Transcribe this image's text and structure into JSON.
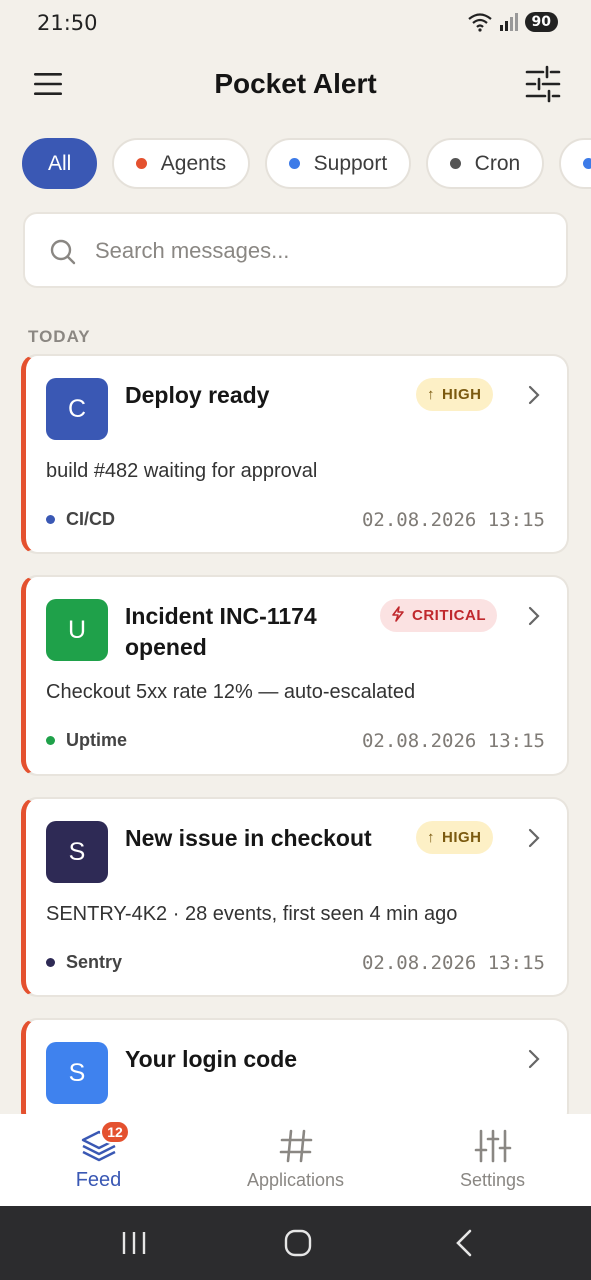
{
  "status_bar": {
    "time": "21:50",
    "battery": "90"
  },
  "header": {
    "title": "Pocket Alert",
    "menu_icon": "hamburger-menu-icon",
    "filter_icon": "sliders-filter-icon"
  },
  "filters": [
    {
      "label": "All",
      "active": true,
      "color": ""
    },
    {
      "label": "Agents",
      "active": false,
      "color": "#e4512f"
    },
    {
      "label": "Support",
      "active": false,
      "color": "#3d7be8"
    },
    {
      "label": "Cron",
      "active": false,
      "color": "#555555"
    }
  ],
  "search": {
    "placeholder": "Search messages..."
  },
  "section": {
    "label": "TODAY"
  },
  "messages": [
    {
      "avatar": "C",
      "avatar_color": "#3a58b4",
      "title": "Deploy ready",
      "priority": "HIGH",
      "priority_icon": "arrow-up-icon",
      "body": "build #482 waiting for approval",
      "source": "CI/CD",
      "source_color": "#3a58b4",
      "time": "02.08.2026 13:15"
    },
    {
      "avatar": "U",
      "avatar_color": "#1fa14a",
      "title": "Incident INC-1174 opened",
      "priority": "CRITICAL",
      "priority_icon": "lightning-icon",
      "body": "Checkout 5xx rate 12% — auto-escalated",
      "source": "Uptime",
      "source_color": "#1fa14a",
      "time": "02.08.2026 13:15"
    },
    {
      "avatar": "S",
      "avatar_color": "#2e2a55",
      "title": "New issue in checkout",
      "priority": "HIGH",
      "priority_icon": "arrow-up-icon",
      "body": "SENTRY-4K2 · 28 events, first seen 4 min ago",
      "source": "Sentry",
      "source_color": "#2e2a55",
      "time": "02.08.2026 13:15"
    },
    {
      "avatar": "S",
      "avatar_color": "#3f82ee",
      "title": "Your login code"
    }
  ],
  "bottom_nav": {
    "feed": {
      "label": "Feed",
      "badge": "12"
    },
    "applications": {
      "label": "Applications"
    },
    "settings": {
      "label": "Settings"
    }
  },
  "colors": {
    "accent": "#3a58b4",
    "alert_stripe": "#e4512f",
    "background": "#f3f0ea"
  }
}
